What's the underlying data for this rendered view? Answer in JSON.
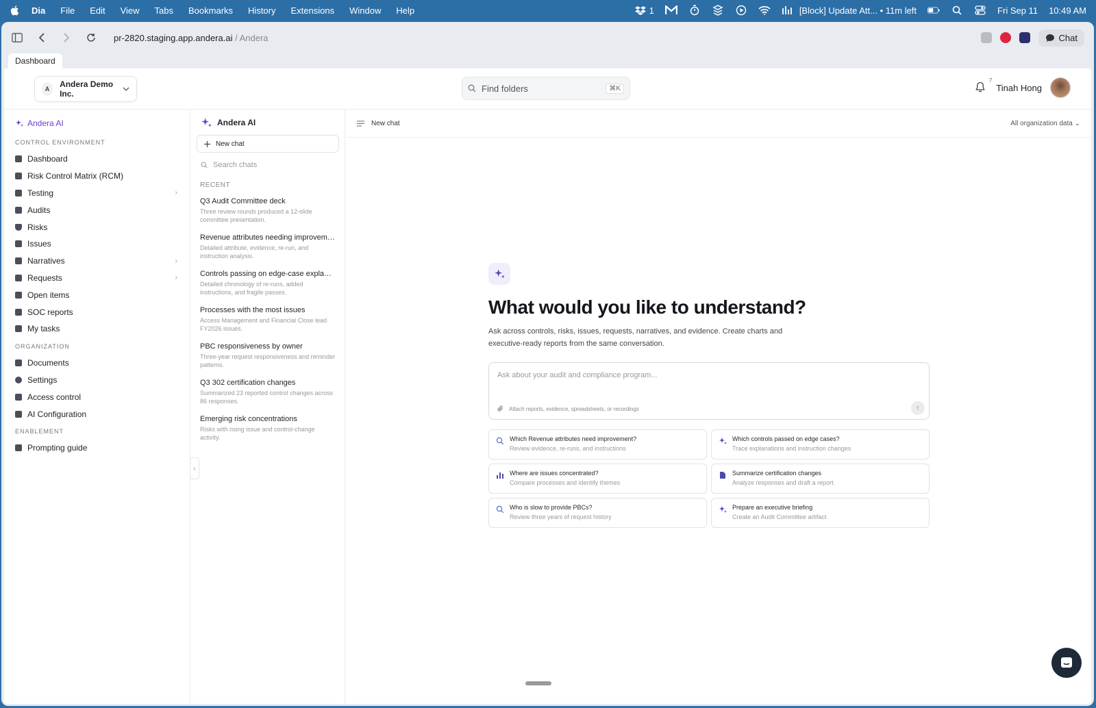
{
  "menubar": {
    "app_name": "Dia",
    "items": [
      "File",
      "Edit",
      "View",
      "Tabs",
      "Bookmarks",
      "History",
      "Extensions",
      "Window",
      "Help"
    ],
    "notif_count": "1",
    "now_playing": "[Block] Update Att... • 11m left",
    "date": "Fri Sep 11",
    "time": "10:49 AM"
  },
  "browser": {
    "url_host": "pr-2820.staging.app.andera.ai",
    "url_suffix": " / Andera",
    "chat_button": "Chat",
    "tab": "Dashboard"
  },
  "header": {
    "org_initial": "A",
    "org_name": "Andera Demo Inc.",
    "search_placeholder": "Find folders",
    "shortcut": "⌘K",
    "notif_count": "7",
    "user_name": "Tinah Hong"
  },
  "sidebar": {
    "ai_label": "Andera AI",
    "sections": [
      {
        "title": "CONTROL ENVIRONMENT",
        "items": [
          {
            "label": "Dashboard"
          },
          {
            "label": "Risk Control Matrix (RCM)"
          },
          {
            "label": "Testing",
            "expand": "›"
          },
          {
            "label": "Audits"
          },
          {
            "label": "Risks"
          },
          {
            "label": "Issues"
          },
          {
            "label": "Narratives",
            "expand": "›"
          },
          {
            "label": "Requests",
            "expand": "›"
          },
          {
            "label": "Open items"
          },
          {
            "label": "SOC reports"
          },
          {
            "label": "My tasks"
          }
        ]
      },
      {
        "title": "ORGANIZATION",
        "items": [
          {
            "label": "Documents"
          },
          {
            "label": "Settings"
          },
          {
            "label": "Access control"
          },
          {
            "label": "AI Configuration"
          }
        ]
      },
      {
        "title": "ENABLEMENT",
        "items": [
          {
            "label": "Prompting guide"
          }
        ]
      }
    ]
  },
  "chatlist": {
    "title": "Andera AI",
    "new_chat": "New chat",
    "search_placeholder": "Search chats",
    "recent_label": "RECENT",
    "chats": [
      {
        "title": "Q3 Audit Committee deck",
        "sub": "Three review rounds produced a 12-slide committee presentation."
      },
      {
        "title": "Revenue attributes needing improvement",
        "sub": "Detailed attribute, evidence, re-run, and instruction analysis."
      },
      {
        "title": "Controls passing on edge-case explanati...",
        "sub": "Detailed chronology of re-runs, added instructions, and fragile passes."
      },
      {
        "title": "Processes with the most issues",
        "sub": "Access Management and Financial Close lead FY2026 issues."
      },
      {
        "title": "PBC responsiveness by owner",
        "sub": "Three-year request responsiveness and reminder patterns."
      },
      {
        "title": "Q3 302 certification changes",
        "sub": "Summarized 23 reported control changes across 86 responses."
      },
      {
        "title": "Emerging risk concentrations",
        "sub": "Risks with rising issue and control-change activity."
      }
    ]
  },
  "main": {
    "top_title": "New chat",
    "scope": "All organization data ⌄",
    "heading": "What would you like to understand?",
    "subheading": "Ask across controls, risks, issues, requests, narratives, and evidence. Create charts and executive-ready reports from the same conversation.",
    "prompt_placeholder": "Ask about your audit and compliance program...",
    "attach_hint": "Attach reports, evidence, spreadsheets, or recordings",
    "suggestions": [
      {
        "q": "Which Revenue attributes need improvement?",
        "d": "Review evidence, re-runs, and instructions",
        "icon": "search-icon"
      },
      {
        "q": "Which controls passed on edge cases?",
        "d": "Trace explanations and instruction changes",
        "icon": "sparkle-icon"
      },
      {
        "q": "Where are issues concentrated?",
        "d": "Compare processes and identify themes",
        "icon": "bar-chart-icon"
      },
      {
        "q": "Summarize certification changes",
        "d": "Analyze responses and draft a report",
        "icon": "document-icon"
      },
      {
        "q": "Who is slow to provide PBCs?",
        "d": "Review three years of request history",
        "icon": "search-icon"
      },
      {
        "q": "Prepare an executive briefing",
        "d": "Create an Audit Committee artifact",
        "icon": "sparkle-icon"
      }
    ]
  },
  "colors": {
    "accent": "#6b3fd0",
    "menubar": "#2c6ea6"
  }
}
